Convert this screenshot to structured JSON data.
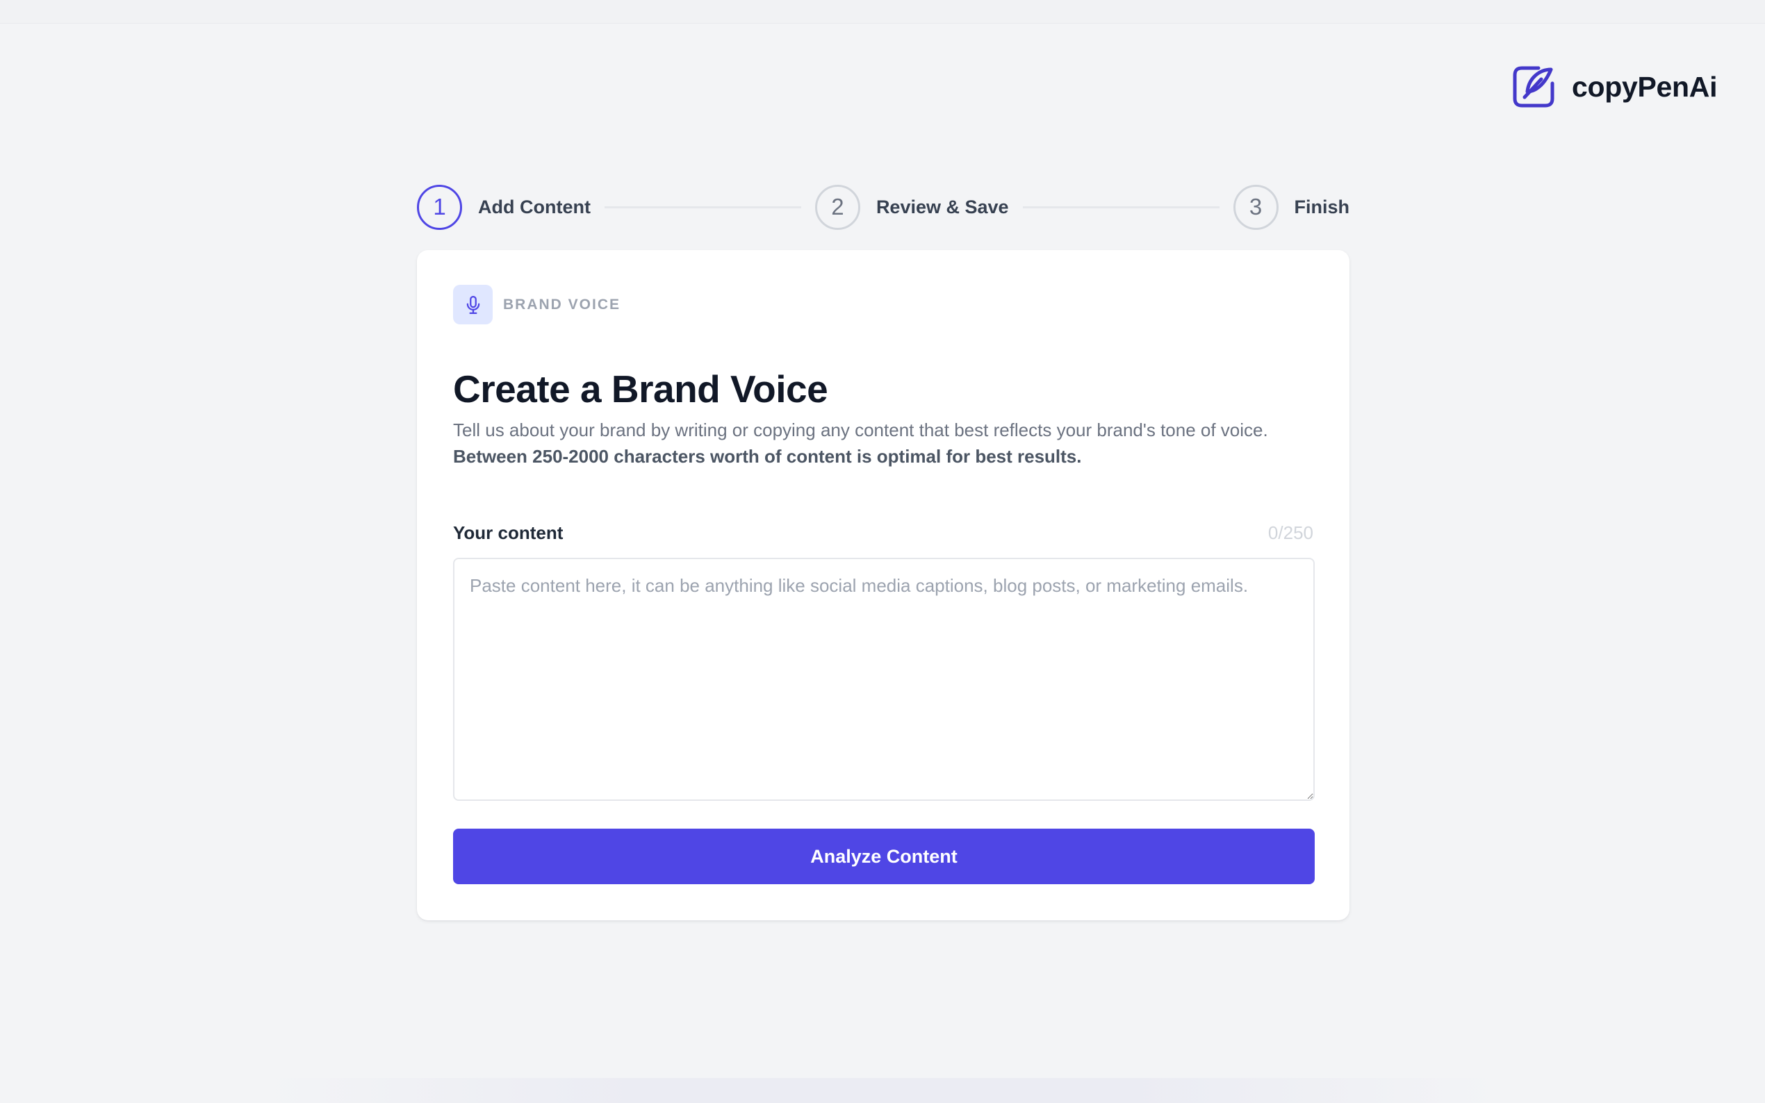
{
  "brand": {
    "name": "copyPenAi",
    "accent_color": "#4f46e5"
  },
  "stepper": {
    "steps": [
      {
        "number": "1",
        "label": "Add Content",
        "state": "active"
      },
      {
        "number": "2",
        "label": "Review & Save",
        "state": "upcoming"
      },
      {
        "number": "3",
        "label": "Finish",
        "state": "upcoming"
      }
    ]
  },
  "card": {
    "badge": {
      "icon": "microphone-icon",
      "label": "BRAND VOICE"
    },
    "title": "Create a Brand Voice",
    "description": "Tell us about your brand by writing or copying any content that best reflects your brand's tone of voice.",
    "description_emphasis": "Between 250-2000 characters worth of content is optimal for best results.",
    "field": {
      "label": "Your content",
      "count": "0/250",
      "value": "",
      "placeholder": "Paste content here, it can be anything like social media captions, blog posts, or marketing emails."
    },
    "submit_label": "Analyze Content"
  }
}
